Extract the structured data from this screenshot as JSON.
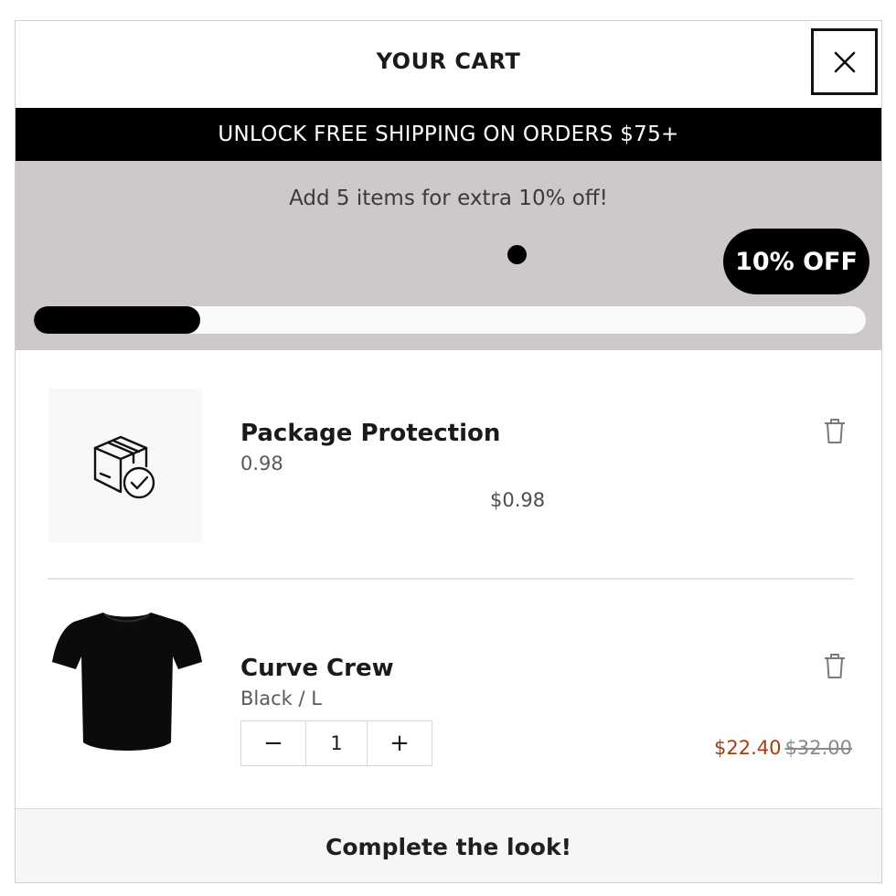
{
  "header": {
    "title": "YOUR CART",
    "close_icon": "close-icon"
  },
  "promo_banner": {
    "text": "UNLOCK FREE SHIPPING ON ORDERS $75+"
  },
  "tier_progress": {
    "message": "Add 5 items for extra 10% off!",
    "badge": "10% OFF",
    "progress_fraction": 0.2
  },
  "cart": {
    "items": [
      {
        "name": "Package Protection",
        "variant": "0.98",
        "price": "$0.98",
        "icon": "package-protection-icon"
      },
      {
        "name": "Curve Crew",
        "variant": "Black / L",
        "quantity": "1",
        "decrement_label": "−",
        "increment_label": "+",
        "sale_price": "$22.40",
        "original_price": "$32.00",
        "icon": "t-shirt-icon"
      }
    ]
  },
  "footer": {
    "text": "Complete the look!"
  },
  "colors": {
    "accent": "#000000",
    "tier_background": "#cdc9c9",
    "sale_price": "#a63c14"
  }
}
